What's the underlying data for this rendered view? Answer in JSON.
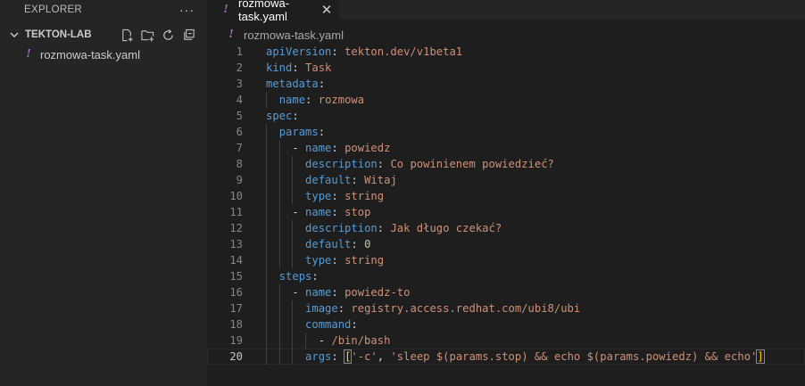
{
  "explorer": {
    "title": "EXPLORER",
    "more": "···",
    "folder": "TEKTON-LAB",
    "file": "rozmowa-task.yaml"
  },
  "tab": {
    "label": "rozmowa-task.yaml",
    "close": "✕"
  },
  "breadcrumb": {
    "file": "rozmowa-task.yaml"
  },
  "lines": [
    {
      "num": "1",
      "indent": 0,
      "tokens": [
        {
          "t": "apiVersion",
          "c": "k"
        },
        {
          "t": ": ",
          "c": "p"
        },
        {
          "t": "tekton.dev/v1beta1",
          "c": "s"
        }
      ]
    },
    {
      "num": "2",
      "indent": 0,
      "tokens": [
        {
          "t": "kind",
          "c": "k"
        },
        {
          "t": ": ",
          "c": "p"
        },
        {
          "t": "Task",
          "c": "s"
        }
      ]
    },
    {
      "num": "3",
      "indent": 0,
      "tokens": [
        {
          "t": "metadata",
          "c": "k"
        },
        {
          "t": ":",
          "c": "p"
        }
      ]
    },
    {
      "num": "4",
      "indent": 1,
      "tokens": [
        {
          "t": "  ",
          "c": "p"
        },
        {
          "t": "name",
          "c": "k"
        },
        {
          "t": ": ",
          "c": "p"
        },
        {
          "t": "rozmowa",
          "c": "s"
        }
      ]
    },
    {
      "num": "5",
      "indent": 0,
      "tokens": [
        {
          "t": "spec",
          "c": "k"
        },
        {
          "t": ":",
          "c": "p"
        }
      ]
    },
    {
      "num": "6",
      "indent": 1,
      "tokens": [
        {
          "t": "  ",
          "c": "p"
        },
        {
          "t": "params",
          "c": "k"
        },
        {
          "t": ":",
          "c": "p"
        }
      ]
    },
    {
      "num": "7",
      "indent": 2,
      "tokens": [
        {
          "t": "    - ",
          "c": "p"
        },
        {
          "t": "name",
          "c": "k"
        },
        {
          "t": ": ",
          "c": "p"
        },
        {
          "t": "powiedz",
          "c": "s"
        }
      ]
    },
    {
      "num": "8",
      "indent": 3,
      "tokens": [
        {
          "t": "      ",
          "c": "p"
        },
        {
          "t": "description",
          "c": "k"
        },
        {
          "t": ": ",
          "c": "p"
        },
        {
          "t": "Co powinienem powiedzieć?",
          "c": "s"
        }
      ]
    },
    {
      "num": "9",
      "indent": 3,
      "tokens": [
        {
          "t": "      ",
          "c": "p"
        },
        {
          "t": "default",
          "c": "k"
        },
        {
          "t": ": ",
          "c": "p"
        },
        {
          "t": "Witaj",
          "c": "s"
        }
      ]
    },
    {
      "num": "10",
      "indent": 3,
      "tokens": [
        {
          "t": "      ",
          "c": "p"
        },
        {
          "t": "type",
          "c": "k"
        },
        {
          "t": ": ",
          "c": "p"
        },
        {
          "t": "string",
          "c": "s"
        }
      ]
    },
    {
      "num": "11",
      "indent": 2,
      "tokens": [
        {
          "t": "    - ",
          "c": "p"
        },
        {
          "t": "name",
          "c": "k"
        },
        {
          "t": ": ",
          "c": "p"
        },
        {
          "t": "stop",
          "c": "s"
        }
      ]
    },
    {
      "num": "12",
      "indent": 3,
      "tokens": [
        {
          "t": "      ",
          "c": "p"
        },
        {
          "t": "description",
          "c": "k"
        },
        {
          "t": ": ",
          "c": "p"
        },
        {
          "t": "Jak długo czekać?",
          "c": "s"
        }
      ]
    },
    {
      "num": "13",
      "indent": 3,
      "tokens": [
        {
          "t": "      ",
          "c": "p"
        },
        {
          "t": "default",
          "c": "k"
        },
        {
          "t": ": ",
          "c": "p"
        },
        {
          "t": "0",
          "c": "n"
        }
      ]
    },
    {
      "num": "14",
      "indent": 3,
      "tokens": [
        {
          "t": "      ",
          "c": "p"
        },
        {
          "t": "type",
          "c": "k"
        },
        {
          "t": ": ",
          "c": "p"
        },
        {
          "t": "string",
          "c": "s"
        }
      ]
    },
    {
      "num": "15",
      "indent": 1,
      "tokens": [
        {
          "t": "  ",
          "c": "p"
        },
        {
          "t": "steps",
          "c": "k"
        },
        {
          "t": ":",
          "c": "p"
        }
      ]
    },
    {
      "num": "16",
      "indent": 2,
      "tokens": [
        {
          "t": "    - ",
          "c": "p"
        },
        {
          "t": "name",
          "c": "k"
        },
        {
          "t": ": ",
          "c": "p"
        },
        {
          "t": "powiedz-to",
          "c": "s"
        }
      ]
    },
    {
      "num": "17",
      "indent": 3,
      "tokens": [
        {
          "t": "      ",
          "c": "p"
        },
        {
          "t": "image",
          "c": "k"
        },
        {
          "t": ": ",
          "c": "p"
        },
        {
          "t": "registry.access.redhat.com/ubi8/ubi",
          "c": "s"
        }
      ]
    },
    {
      "num": "18",
      "indent": 3,
      "tokens": [
        {
          "t": "      ",
          "c": "p"
        },
        {
          "t": "command",
          "c": "k"
        },
        {
          "t": ":",
          "c": "p"
        }
      ]
    },
    {
      "num": "19",
      "indent": 4,
      "tokens": [
        {
          "t": "        - ",
          "c": "p"
        },
        {
          "t": "/bin/bash",
          "c": "s"
        }
      ]
    },
    {
      "num": "20",
      "indent": 3,
      "active": true,
      "tokens": [
        {
          "t": "      ",
          "c": "p"
        },
        {
          "t": "args",
          "c": "k"
        },
        {
          "t": ": ",
          "c": "p"
        },
        {
          "t": "[",
          "c": "br"
        },
        {
          "t": "'-c'",
          "c": "s"
        },
        {
          "t": ", ",
          "c": "p"
        },
        {
          "t": "'sleep $(params.stop) && echo $(params.powiedz) && echo'",
          "c": "s"
        },
        {
          "t": "]",
          "c": "br"
        }
      ]
    }
  ]
}
